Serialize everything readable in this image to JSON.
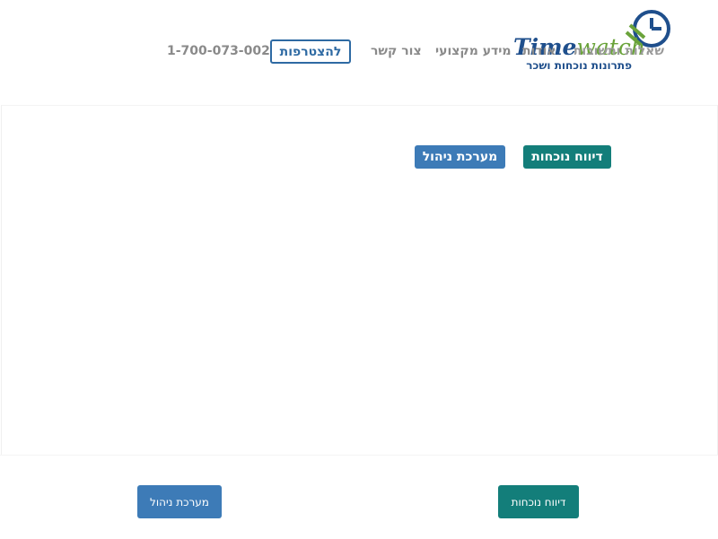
{
  "header": {
    "logo": {
      "word_part1": "Time",
      "word_part2": "watch",
      "tagline": "פתרונות נוכחות ושכר",
      "brand_blue": "#1f4f8c",
      "brand_green": "#6aa33a"
    },
    "nav": {
      "faq": "שאלות ותשובות",
      "about": "אודות",
      "info": "מידע מקצועי",
      "contact": "צור קשר",
      "join": "להצטרפות",
      "phone": "1-700-073-002"
    }
  },
  "main": {
    "attendance_button": "דיווח נוכחות",
    "management_button": "מערכת ניהול"
  },
  "footer": {
    "attendance_button": "דיווח נוכחות",
    "management_button": "מערכת ניהול"
  },
  "colors": {
    "teal": "#137e7a",
    "blue": "#3d7bb7",
    "join_border": "#2e6aa3"
  }
}
